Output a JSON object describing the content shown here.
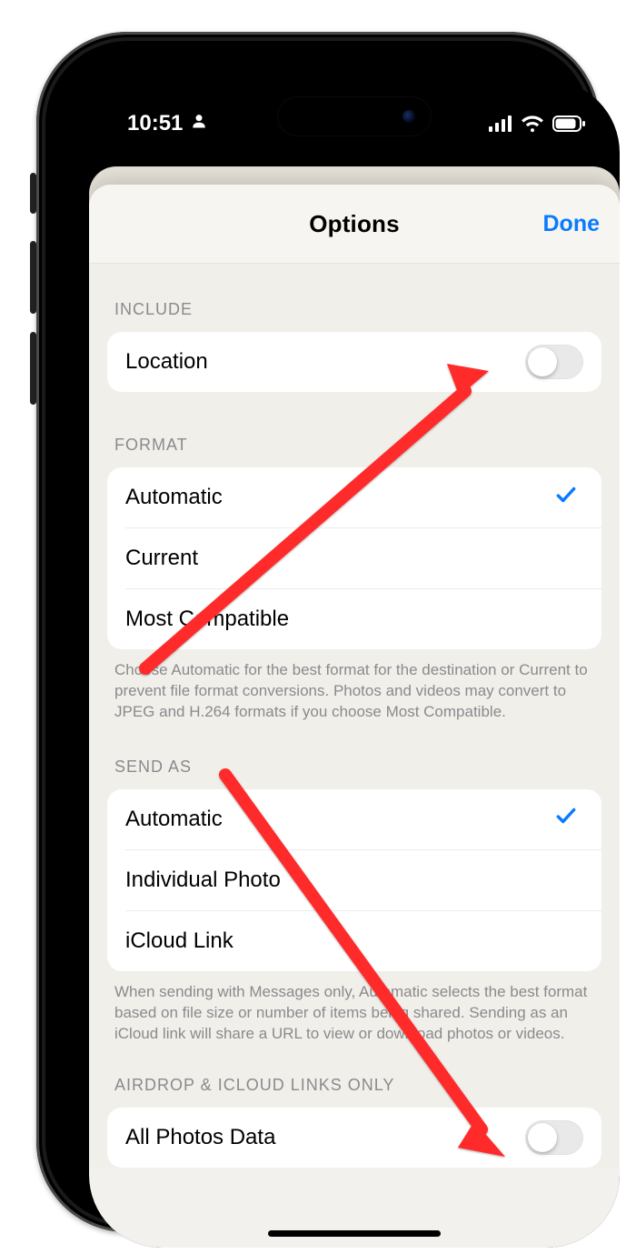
{
  "status": {
    "time": "10:51"
  },
  "nav": {
    "title": "Options",
    "done": "Done"
  },
  "include": {
    "header": "INCLUDE",
    "location_label": "Location",
    "location_on": false
  },
  "format": {
    "header": "FORMAT",
    "options": [
      {
        "label": "Automatic",
        "selected": true
      },
      {
        "label": "Current",
        "selected": false
      },
      {
        "label": "Most Compatible",
        "selected": false
      }
    ],
    "footer": "Choose Automatic for the best format for the destination or Current to prevent file format conversions. Photos and videos may convert to JPEG and H.264 formats if you choose Most Compatible."
  },
  "send_as": {
    "header": "SEND AS",
    "options": [
      {
        "label": "Automatic",
        "selected": true
      },
      {
        "label": "Individual Photo",
        "selected": false
      },
      {
        "label": "iCloud Link",
        "selected": false
      }
    ],
    "footer": "When sending with Messages only, Automatic selects the best format based on file size or number of items being shared. Sending as an iCloud link will share a URL to view or download photos or videos."
  },
  "airdrop": {
    "header": "AIRDROP & ICLOUD LINKS ONLY",
    "all_photos_label": "All Photos Data",
    "all_photos_on": false
  }
}
